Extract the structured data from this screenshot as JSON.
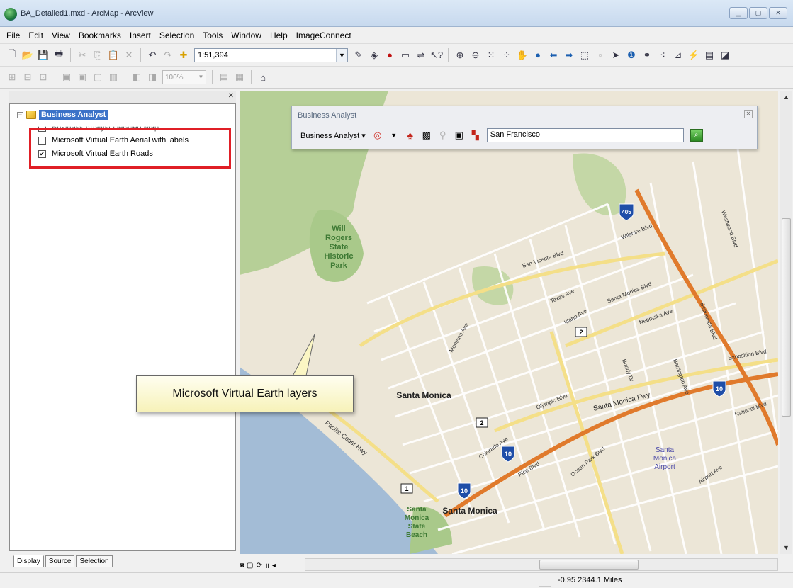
{
  "window": {
    "title": "BA_Detailed1.mxd - ArcMap - ArcView",
    "controls": {
      "minimize": "▁",
      "maximize": "▢",
      "close": "✕"
    }
  },
  "menu": [
    "File",
    "Edit",
    "View",
    "Bookmarks",
    "Insert",
    "Selection",
    "Tools",
    "Window",
    "Help",
    "ImageConnect"
  ],
  "toolbar": {
    "scale_value": "1:51,394",
    "zoom_value": "100%"
  },
  "toc": {
    "root_label": "Business Analyst",
    "hidden_layer": "Business Analyst Detailed Map",
    "layers": [
      {
        "label": "Microsoft Virtual Earth Aerial with labels",
        "checked": false
      },
      {
        "label": "Microsoft Virtual Earth Roads",
        "checked": true
      }
    ],
    "tabs": [
      "Display",
      "Source",
      "Selection"
    ]
  },
  "ba_toolbar": {
    "title": "Business Analyst",
    "menu_label": "Business Analyst ▾",
    "search_value": "San Francisco"
  },
  "callout": {
    "text": "Microsoft Virtual Earth layers"
  },
  "map": {
    "labels": {
      "park": [
        "Will",
        "Rogers",
        "State",
        "Historic",
        "Park"
      ],
      "santa_monica_1": "Santa Monica",
      "santa_monica_2": "Santa Monica",
      "beach": [
        "Santa",
        "Monica",
        "State",
        "Beach"
      ],
      "airport": [
        "Santa",
        "Monica",
        "Airport"
      ],
      "fwy": "Santa Monica Fwy",
      "pch": "Pacific Coast Hwy",
      "route_2a": "2",
      "route_2b": "2",
      "route_1": "1",
      "i10a": "10",
      "i10b": "10",
      "i10c": "10",
      "i405": "405",
      "streets": [
        "San Vicente Blvd",
        "Wilshire Blvd",
        "Santa Monica Blvd",
        "Olympic Blvd",
        "Pico Blvd",
        "Ocean Park Blvd",
        "Montana Ave",
        "Idaho Ave",
        "Exposition Blvd",
        "National Blvd",
        "Texas Ave",
        "Colorado Ave",
        "Airport Ave",
        "Barrington Ave",
        "Bundy Dr",
        "Westwood Blvd",
        "Sepulveda Blvd",
        "Nebraska Ave"
      ]
    }
  },
  "status": {
    "coords": "-0.95  2344.1 Miles"
  },
  "colors": {
    "highlight": "#e01f26",
    "selection": "#3b72c8",
    "road_major": "#e07a2c",
    "road_minor": "#ffffff",
    "park": "#a9c98a",
    "water": "#a3bcd6",
    "land": "#ece6d7"
  }
}
